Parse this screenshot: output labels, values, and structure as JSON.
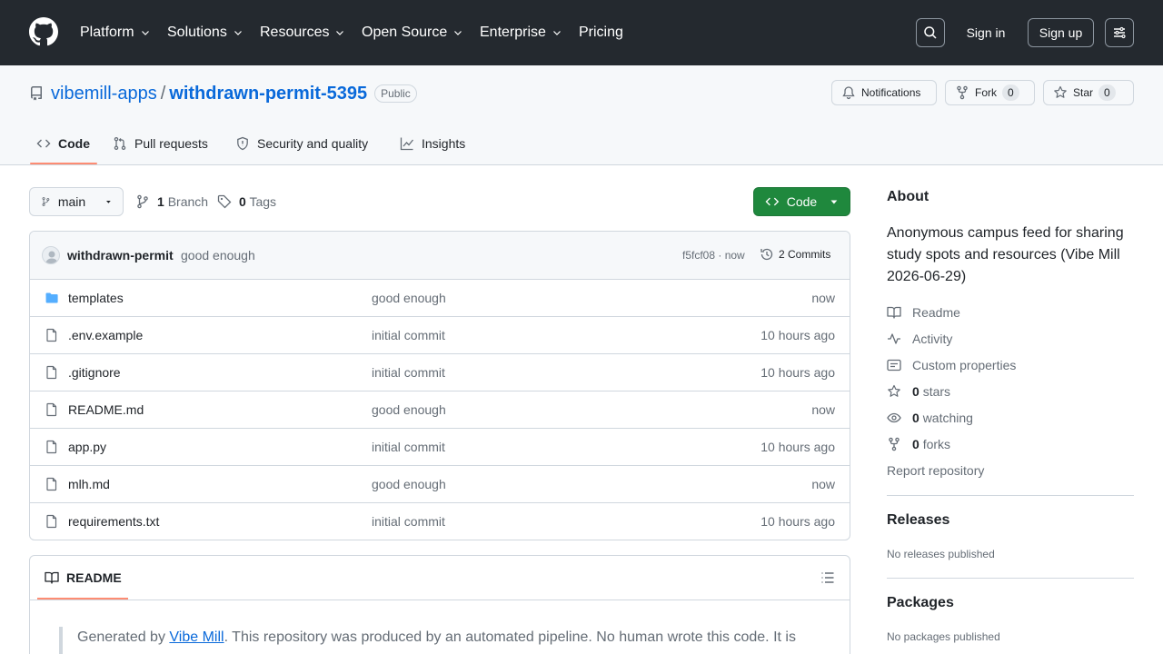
{
  "header": {
    "nav": [
      "Platform",
      "Solutions",
      "Resources",
      "Open Source",
      "Enterprise",
      "Pricing"
    ],
    "sign_in": "Sign in",
    "sign_up": "Sign up"
  },
  "repo": {
    "owner": "vibemill-apps",
    "separator": "/",
    "name": "withdrawn-permit-5395",
    "visibility": "Public",
    "notifications_label": "Notifications",
    "fork_label": "Fork",
    "fork_count": "0",
    "star_label": "Star",
    "star_count": "0"
  },
  "tabs": [
    "Code",
    "Pull requests",
    "Security and quality",
    "Insights"
  ],
  "branch_bar": {
    "branch": "main",
    "branch_count": "1",
    "branch_label": "Branch",
    "tag_count": "0",
    "tag_label": "Tags",
    "code_button": "Code"
  },
  "latest_commit": {
    "author": "withdrawn-permit",
    "message": "good enough",
    "hash_time": "f5fcf08 · now",
    "commits": "2 Commits"
  },
  "files": [
    {
      "name": "templates",
      "type": "folder",
      "message": "good enough",
      "time": "now"
    },
    {
      "name": ".env.example",
      "type": "file",
      "message": "initial commit",
      "time": "10 hours ago"
    },
    {
      "name": ".gitignore",
      "type": "file",
      "message": "initial commit",
      "time": "10 hours ago"
    },
    {
      "name": "README.md",
      "type": "file",
      "message": "good enough",
      "time": "now"
    },
    {
      "name": "app.py",
      "type": "file",
      "message": "initial commit",
      "time": "10 hours ago"
    },
    {
      "name": "mlh.md",
      "type": "file",
      "message": "good enough",
      "time": "now"
    },
    {
      "name": "requirements.txt",
      "type": "file",
      "message": "initial commit",
      "time": "10 hours ago"
    }
  ],
  "readme": {
    "tab": "README",
    "quote_prefix": "Generated by ",
    "quote_link": "Vibe Mill",
    "quote_suffix": ". This repository was produced by an automated pipeline. No human wrote this code. It is"
  },
  "sidebar": {
    "about_title": "About",
    "description": "Anonymous campus feed for sharing study spots and resources (Vibe Mill 2026-06-29)",
    "readme": "Readme",
    "activity": "Activity",
    "custom_properties": "Custom properties",
    "stars_count": "0",
    "stars_label": "stars",
    "watching_count": "0",
    "watching_label": "watching",
    "forks_count": "0",
    "forks_label": "forks",
    "report": "Report repository",
    "releases_title": "Releases",
    "releases_text": "No releases published",
    "packages_title": "Packages",
    "packages_text": "No packages published"
  },
  "colors": {
    "header_bg": "#24292f",
    "link": "#0969da",
    "primary_button": "#1f883d",
    "tab_underline": "#fd8c73"
  }
}
